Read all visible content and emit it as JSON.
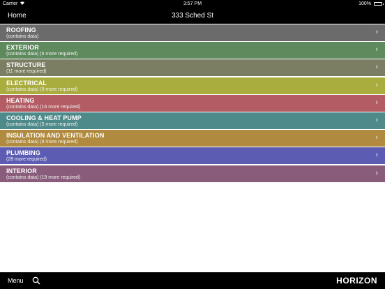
{
  "status_bar": {
    "carrier": "Carrier",
    "wifi_icon": "wifi-icon",
    "time": "3:57 PM",
    "battery_percent": "100%",
    "battery_level": 1.0
  },
  "nav": {
    "back_label": "Home",
    "title": "333 Sched St"
  },
  "sections": [
    {
      "name": "ROOFING",
      "detail": "(contains data)",
      "color": "#6b6b6b"
    },
    {
      "name": "EXTERIOR",
      "detail": "(contains data) (6 more required)",
      "color": "#5e8a5e"
    },
    {
      "name": "STRUCTURE",
      "detail": "(11 more required)",
      "color": "#7c7e63"
    },
    {
      "name": "ELECTRICAL",
      "detail": "(contains data) (9 more required)",
      "color": "#a9ad3e"
    },
    {
      "name": "HEATING",
      "detail": "(contains data) (16 more required)",
      "color": "#b35c63"
    },
    {
      "name": "COOLING & HEAT PUMP",
      "detail": "(contains data) (5 more required)",
      "color": "#4e8a8a"
    },
    {
      "name": "INSULATION AND VENTILATION",
      "detail": "(contains data) (8 more required)",
      "color": "#b08a3e"
    },
    {
      "name": "PLUMBING",
      "detail": "(28 more required)",
      "color": "#5c5cb3"
    },
    {
      "name": "INTERIOR",
      "detail": "(contains data) (19 more required)",
      "color": "#8a5c7c"
    }
  ],
  "bottom_bar": {
    "menu_label": "Menu",
    "search_icon": "search-icon",
    "logo": "HORIZON"
  }
}
